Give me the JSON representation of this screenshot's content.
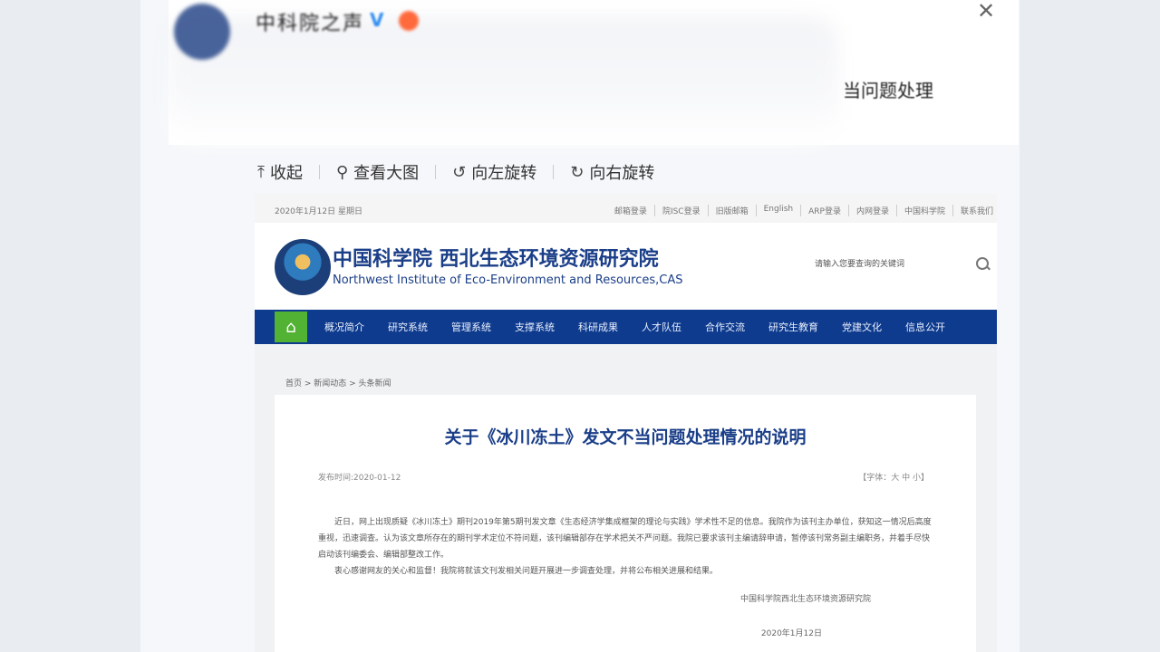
{
  "post": {
    "account_name": "中科院之声",
    "verified_badge": "V",
    "title_fragment": "当问题处理"
  },
  "icons": {
    "close": "close-icon",
    "collapse": "upload-arrow-icon",
    "view_large": "magnifier-icon",
    "rotate_left": "rotate-left-icon",
    "rotate_right": "rotate-right-icon",
    "home": "home-icon",
    "search": "search-icon"
  },
  "toolbar": {
    "collapse": "收起",
    "view_large": "查看大图",
    "rotate_left": "向左旋转",
    "rotate_right": "向右旋转"
  },
  "shot": {
    "date": "2020年1月12日 星期日",
    "top_links": [
      "邮箱登录",
      "院ISC登录",
      "旧版邮箱",
      "English",
      "ARP登录",
      "内网登录",
      "中国科学院",
      "联系我们"
    ],
    "inst_cn": "中国科学院  西北生态环境资源研究院",
    "inst_en": "Northwest Institute of Eco-Environment and Resources,CAS",
    "search_placeholder": "请输入您要查询的关键词",
    "nav": [
      "概况简介",
      "研究系统",
      "管理系统",
      "支撑系统",
      "科研成果",
      "人才队伍",
      "合作交流",
      "研究生教育",
      "党建文化",
      "信息公开"
    ],
    "breadcrumb": "首页 > 新闻动态 > 头条新闻",
    "article_title": "关于《冰川冻土》发文不当问题处理情况的说明",
    "publish_date": "发布时间:2020-01-12",
    "font_size": "【字体：大 中 小】",
    "para1": "近日，网上出现质疑《冰川冻土》期刊2019年第5期刊发文章《生态经济学集成框架的理论与实践》学术性不足的信息。我院作为该刊主办单位，获知这一情况后高度重视，迅速调查。认为该文章所存在的期刊学术定位不符问题，该刊编辑部存在学术把关不严问题。我院已要求该刊主编请辞申请，暂停该刊常务副主编职务，并着手尽快启动该刊编委会、编辑部整改工作。",
    "para2": "衷心感谢网友的关心和监督！我院将就该文刊发相关问题开展进一步调查处理，并将公布相关进展和结果。",
    "signature": "中国科学院西北生态环境资源研究院",
    "sign_date": "2020年1月12日"
  }
}
